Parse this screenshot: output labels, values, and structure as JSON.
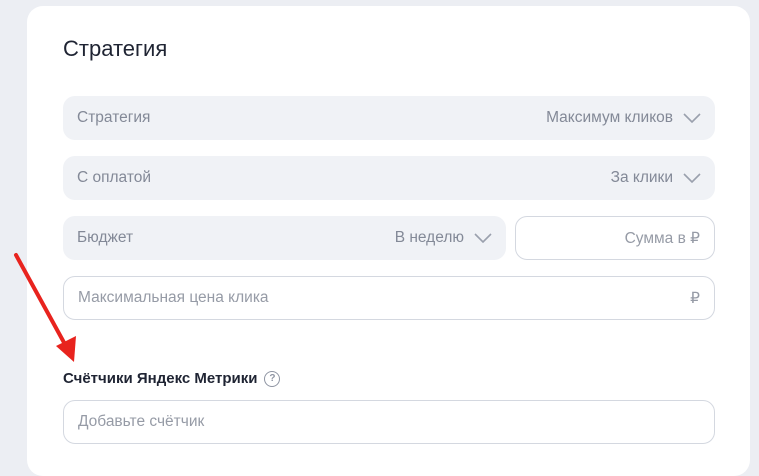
{
  "section_title": "Стратегия",
  "strategy": {
    "label": "Стратегия",
    "value": "Максимум кликов"
  },
  "payment": {
    "label": "С оплатой",
    "value": "За клики"
  },
  "budget": {
    "label": "Бюджет",
    "value": "В неделю",
    "amount_placeholder": "Сумма в ₽"
  },
  "max_price": {
    "placeholder": "Максимальная цена клика",
    "currency": "₽"
  },
  "metrika": {
    "label": "Счётчики Яндекс Метрики",
    "help": "?",
    "placeholder": "Добавьте счётчик"
  },
  "colors": {
    "annotation_arrow": "#e8231e"
  }
}
